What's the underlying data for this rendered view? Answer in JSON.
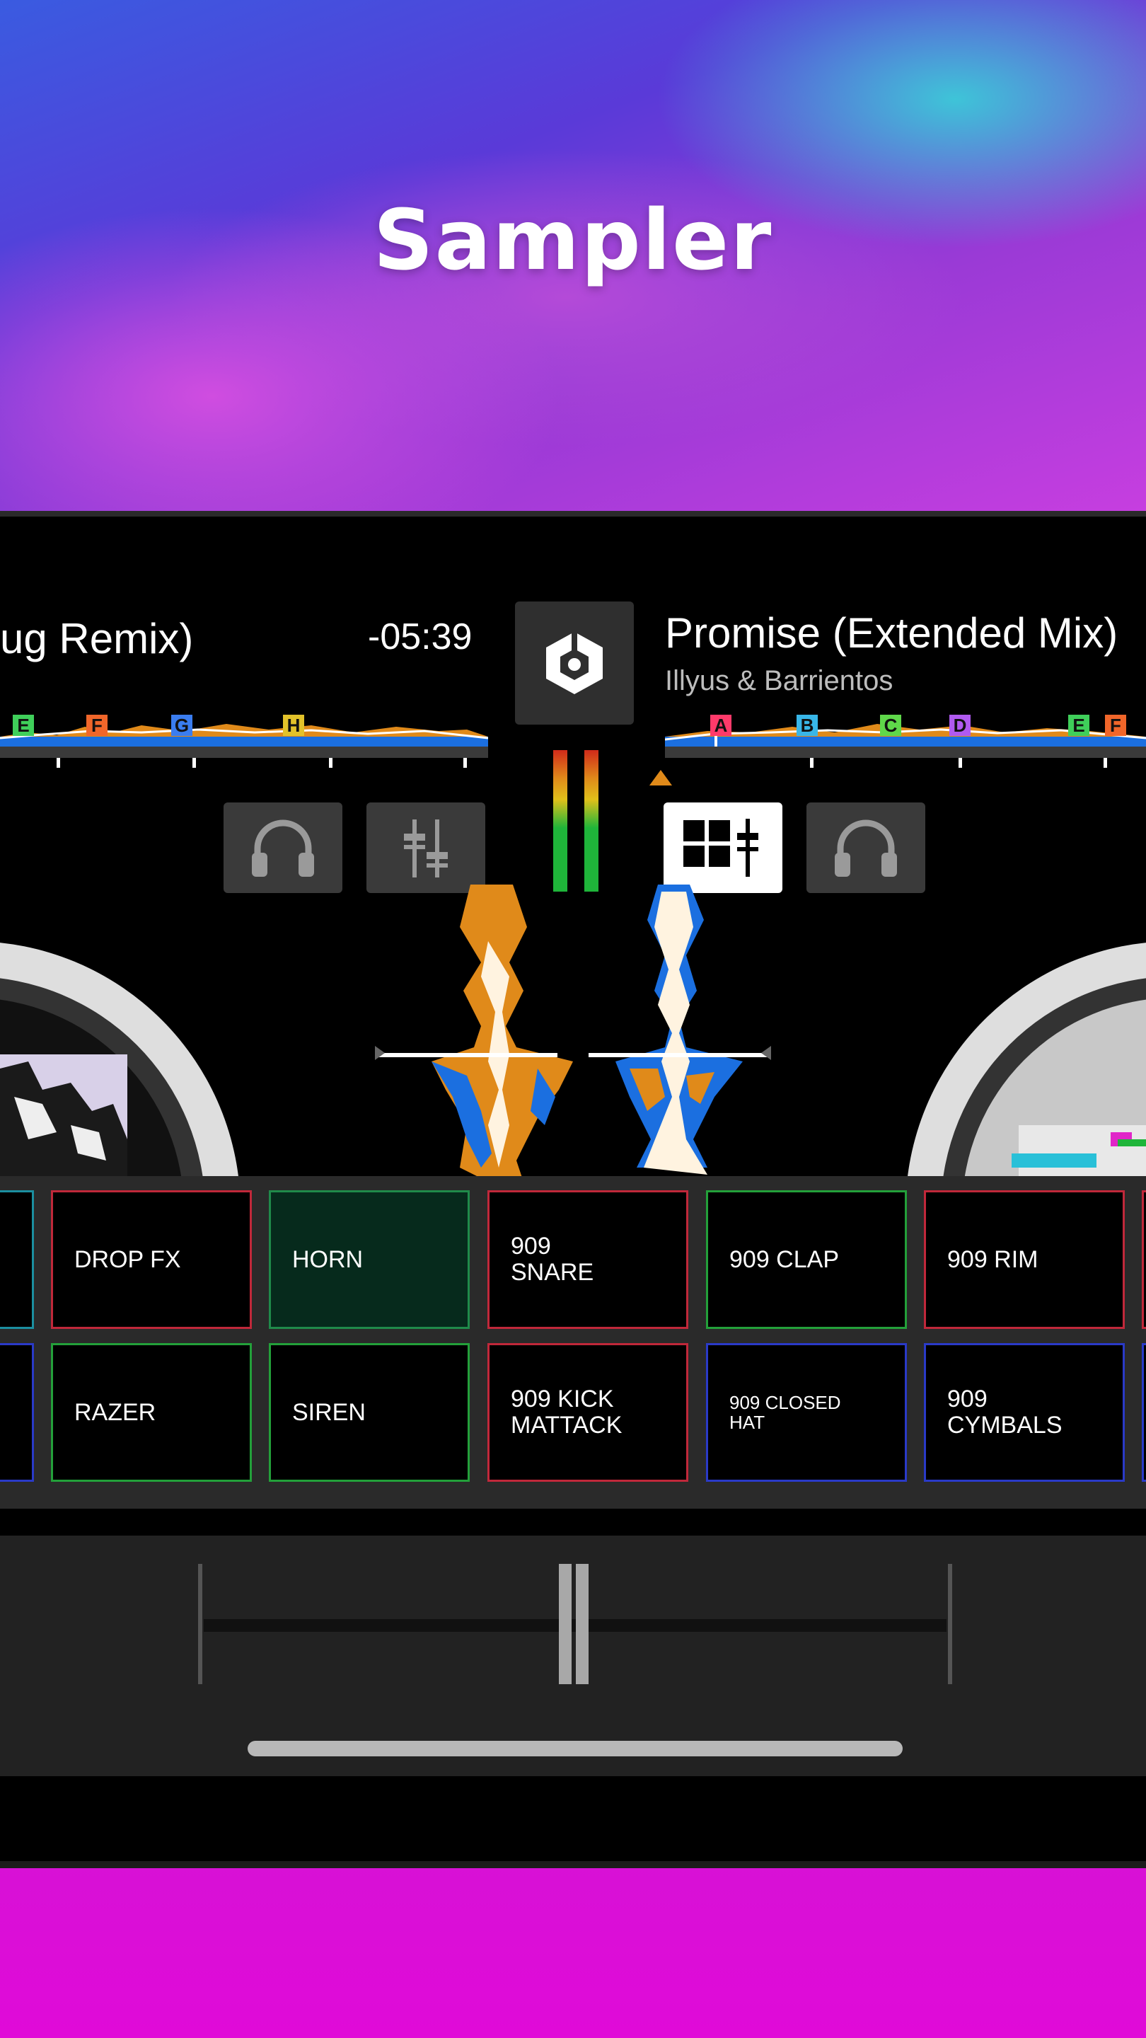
{
  "headline": "Sampler",
  "deck_left": {
    "title": "ug Remix)",
    "time": "-05:39",
    "cues": [
      {
        "label": "E",
        "color": "#3fcf5a"
      },
      {
        "label": "F",
        "color": "#f0662a"
      },
      {
        "label": "G",
        "color": "#3a7df0"
      },
      {
        "label": "H",
        "color": "#e2c22a"
      }
    ]
  },
  "deck_right": {
    "title": "Promise (Extended Mix)",
    "artist": "Illyus & Barrientos",
    "cues": [
      {
        "label": "A",
        "color": "#ff3a6a"
      },
      {
        "label": "B",
        "color": "#38b6e8"
      },
      {
        "label": "C",
        "color": "#5fd84a"
      },
      {
        "label": "D",
        "color": "#b05af0"
      },
      {
        "label": "E",
        "color": "#3fcf5a"
      },
      {
        "label": "F",
        "color": "#f0662a"
      }
    ]
  },
  "controls": {
    "headphones_left_icon": "headphones-icon",
    "mixer_icon": "mixer-faders-icon",
    "sampler_icon": "sampler-pads-icon",
    "headphones_right_icon": "headphones-icon"
  },
  "sampler": {
    "row1": [
      {
        "label": "DROP FX",
        "border": "#c0283a",
        "bg": "#000000"
      },
      {
        "label": "HORN",
        "border": "#1f8a4a",
        "bg": "#062a1c"
      },
      {
        "label": "909\nSNARE",
        "border": "#c0283a",
        "bg": "#000000"
      },
      {
        "label": "909 CLAP",
        "border": "#23a03a",
        "bg": "#000000"
      },
      {
        "label": "909 RIM",
        "border": "#c0283a",
        "bg": "#000000"
      }
    ],
    "row2": [
      {
        "label": "RAZER",
        "border": "#23a03a",
        "bg": "#000000"
      },
      {
        "label": "SIREN",
        "border": "#23a03a",
        "bg": "#000000"
      },
      {
        "label": "909 KICK\nMATTACK",
        "border": "#c0283a",
        "bg": "#000000"
      },
      {
        "label": "909 CLOSED\nHAT",
        "border": "#2a3ac8",
        "bg": "#000000",
        "small": true
      },
      {
        "label": "909\nCYMBALS",
        "border": "#2a3ac8",
        "bg": "#000000"
      }
    ]
  },
  "colors": {
    "accent_blue": "#1b6fe0",
    "accent_orange": "#e08a1a",
    "meter_green": "#1fb53a"
  }
}
